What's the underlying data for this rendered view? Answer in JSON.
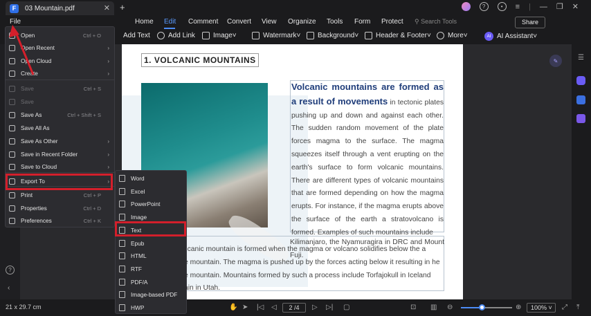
{
  "tab": {
    "title": "03 Mountain.pdf"
  },
  "menubar": {
    "file": "File",
    "items": [
      "Home",
      "Edit",
      "Comment",
      "Convert",
      "View",
      "Organize",
      "Tools",
      "Form",
      "Protect"
    ],
    "active": "Edit",
    "search_placeholder": "Search Tools",
    "share": "Share"
  },
  "toolbar": {
    "add_text": "Add Text",
    "add_link": "Add Link",
    "image": "Image",
    "watermark": "Watermark",
    "background": "Background",
    "header_footer": "Header & Footer",
    "more": "More",
    "ai_assistant": "AI Assistant"
  },
  "file_menu": {
    "items": [
      {
        "label": "Open",
        "shortcut": "Ctrl + O",
        "arrow": false,
        "disabled": false
      },
      {
        "label": "Open Recent",
        "shortcut": "",
        "arrow": true,
        "disabled": false
      },
      {
        "label": "Open Cloud",
        "shortcut": "",
        "arrow": true,
        "disabled": false
      },
      {
        "label": "Create",
        "shortcut": "",
        "arrow": true,
        "disabled": false
      },
      {
        "label": "Save",
        "shortcut": "Ctrl + S",
        "arrow": false,
        "disabled": true
      },
      {
        "label": "Save",
        "shortcut": "",
        "arrow": false,
        "disabled": true
      },
      {
        "label": "Save As",
        "shortcut": "Ctrl + Shift + S",
        "arrow": false,
        "disabled": false
      },
      {
        "label": "Save All As",
        "shortcut": "",
        "arrow": false,
        "disabled": false
      },
      {
        "label": "Save As Other",
        "shortcut": "",
        "arrow": true,
        "disabled": false
      },
      {
        "label": "Save in Recent Folder",
        "shortcut": "",
        "arrow": true,
        "disabled": false
      },
      {
        "label": "Save to Cloud",
        "shortcut": "",
        "arrow": true,
        "disabled": false
      },
      {
        "label": "Export To",
        "shortcut": "",
        "arrow": true,
        "disabled": false
      },
      {
        "label": "Print",
        "shortcut": "Ctrl + P",
        "arrow": false,
        "disabled": false
      },
      {
        "label": "Properties",
        "shortcut": "Ctrl + D",
        "arrow": false,
        "disabled": false
      },
      {
        "label": "Preferences",
        "shortcut": "Ctrl + K",
        "arrow": false,
        "disabled": false
      }
    ]
  },
  "export_submenu": {
    "items": [
      "Word",
      "Excel",
      "PowerPoint",
      "Image",
      "Text",
      "Epub",
      "HTML",
      "RTF",
      "PDF/A",
      "Image-based PDF",
      "HWP"
    ]
  },
  "document": {
    "heading": "1. VOLCANIC MOUNTAINS",
    "lead": "Volcanic mountains are formed as a result of movements",
    "para1": " in tectonic plates pushing up and down and against each other. The sudden random movement of the plate forces magma to the surface. The magma squeezes itself through a vent erupting on the earth's surface to form volcanic mountains. There are different types of volcanic mountains that are formed depending on how the magma erupts. For instance, if the magma erupts above the surface of the earth a stratovolcano is formed. Examples of such mountains include",
    "para2": "Kilimanjaro, the Nyamuragira in DRC and Mount Fuji.",
    "para3": "of volcanic mountain is formed when the magma or volcano solidifies below the a dome mountain. The magma is pushed up by the forces acting below it resulting in he dome mountain. Mountains formed by such a process include Torfajokull in Iceland ountain in Utah."
  },
  "status": {
    "dimensions": "21 x 29.7 cm",
    "page": "2 /4",
    "zoom": "100%",
    "zoom_level": 0.4
  },
  "colors": {
    "accent": "#4d8cf5",
    "highlight": "#d31f2b"
  }
}
